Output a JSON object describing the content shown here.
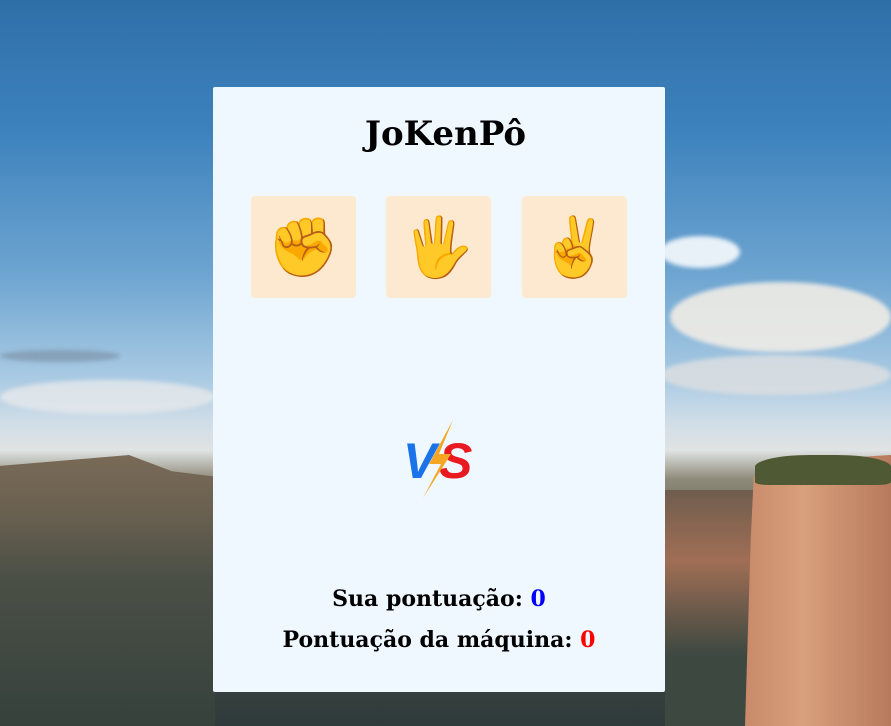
{
  "app": {
    "title": "JoKenPô"
  },
  "choices": [
    {
      "id": "rock",
      "icon": "raised-fist-icon",
      "glyph": "✊"
    },
    {
      "id": "paper",
      "icon": "raised-hand-icon",
      "glyph": "🖐"
    },
    {
      "id": "scissors",
      "icon": "victory-hand-icon",
      "glyph": "✌"
    }
  ],
  "versus": {
    "left_letter": "V",
    "right_letter": "S",
    "icon": "vs-lightning-icon"
  },
  "score": {
    "player_label": "Sua pontuação:",
    "player_value": "0",
    "machine_label": "Pontuação da máquina:",
    "machine_value": "0"
  },
  "colors": {
    "card_bg": "#f0f8ff",
    "choice_bg": "#fde9cf",
    "player_score": "#0000ff",
    "machine_score": "#ff0000",
    "vs_blue": "#1a73e8",
    "vs_red": "#e8191f",
    "vs_bolt": "#f5a623"
  }
}
